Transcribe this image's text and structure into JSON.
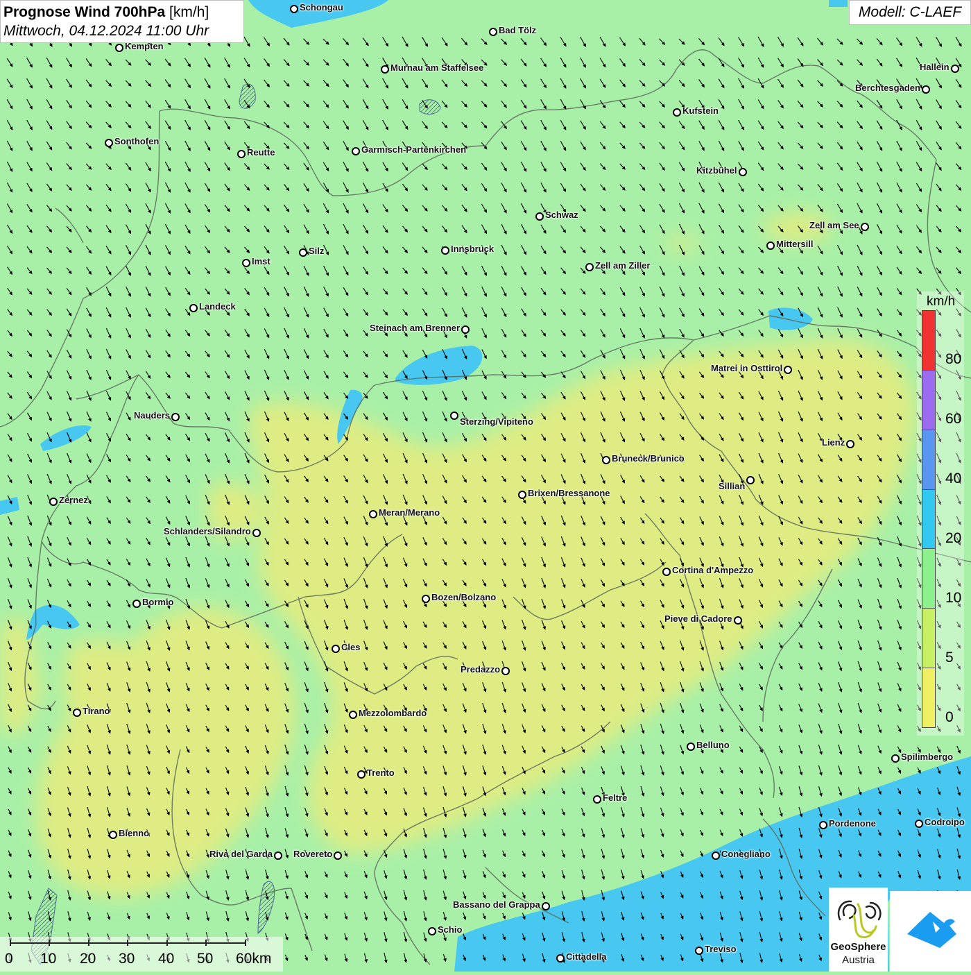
{
  "title": {
    "main": "Prognose Wind 700hPa",
    "unit": "[km/h]",
    "datetime": "Mittwoch, 04.12.2024 11:00 Uhr"
  },
  "model": "Modell: C-LAEF",
  "legend": {
    "unit": "km/h",
    "ticks": [
      "80",
      "60",
      "40",
      "20",
      "10",
      "5",
      "0"
    ],
    "colors_top_to_bottom": [
      "#f03232",
      "#f03232",
      "#9b6cf0",
      "#9b6cf0",
      "#5a96f0",
      "#5a96f0",
      "#32c8f0",
      "#32c8f0",
      "#8cf08c",
      "#8cf08c",
      "#c8f064",
      "#c8f064",
      "#f0f064",
      "#f0f064"
    ]
  },
  "scale": {
    "labels": [
      "0",
      "10",
      "20",
      "30",
      "40",
      "50",
      "60km"
    ]
  },
  "logo": {
    "name_line1": "GeoSphere",
    "name_line2": "Austria"
  },
  "colors": {
    "calm_yellow": "#e4ec80",
    "light_green": "#a8f0a8",
    "water_blue": "#48c8f0",
    "arrow": "#000000"
  },
  "wind": {
    "prevailing_direction": "north-northwest",
    "field_range_kmh": [
      0,
      25
    ]
  },
  "cities": [
    {
      "name": "Schongau"
    },
    {
      "name": "Kempten"
    },
    {
      "name": "Bad Tölz"
    },
    {
      "name": "Murnau am Staffelsee"
    },
    {
      "name": "Hallein"
    },
    {
      "name": "Berchtesgaden"
    },
    {
      "name": "Kufstein"
    },
    {
      "name": "Sonthofen"
    },
    {
      "name": "Reutte"
    },
    {
      "name": "Garmisch-Partenkirchen"
    },
    {
      "name": "Kitzbühel"
    },
    {
      "name": "Schwaz"
    },
    {
      "name": "Zell am See"
    },
    {
      "name": "Innsbruck"
    },
    {
      "name": "Mittersill"
    },
    {
      "name": "Silz"
    },
    {
      "name": "Imst"
    },
    {
      "name": "Zell am Ziller"
    },
    {
      "name": "Landeck"
    },
    {
      "name": "Steinach am Brenner"
    },
    {
      "name": "Matrei in Osttirol"
    },
    {
      "name": "Nauders"
    },
    {
      "name": "Sterzing/Vipiteno"
    },
    {
      "name": "Lienz"
    },
    {
      "name": "Bruneck/Brunico"
    },
    {
      "name": "Sillian"
    },
    {
      "name": "Zernez"
    },
    {
      "name": "Brixen/Bressanone"
    },
    {
      "name": "Meran/Merano"
    },
    {
      "name": "Schlanders/Silandro"
    },
    {
      "name": "Cortina d'Ampezzo"
    },
    {
      "name": "Bozen/Bolzano"
    },
    {
      "name": "Bormio"
    },
    {
      "name": "Pieve di Cadore"
    },
    {
      "name": "Cles"
    },
    {
      "name": "Predazzo"
    },
    {
      "name": "Tirano"
    },
    {
      "name": "Mezzolombardo"
    },
    {
      "name": "Belluno"
    },
    {
      "name": "Spilimbergo"
    },
    {
      "name": "Trento"
    },
    {
      "name": "Feltre"
    },
    {
      "name": "Pordenone"
    },
    {
      "name": "Codroipo"
    },
    {
      "name": "Bienno"
    },
    {
      "name": "Riva del Garda"
    },
    {
      "name": "Rovereto"
    },
    {
      "name": "Conegliano"
    },
    {
      "name": "Bassano del Grappa"
    },
    {
      "name": "Schio"
    },
    {
      "name": "Treviso"
    },
    {
      "name": "Cittadella"
    }
  ]
}
